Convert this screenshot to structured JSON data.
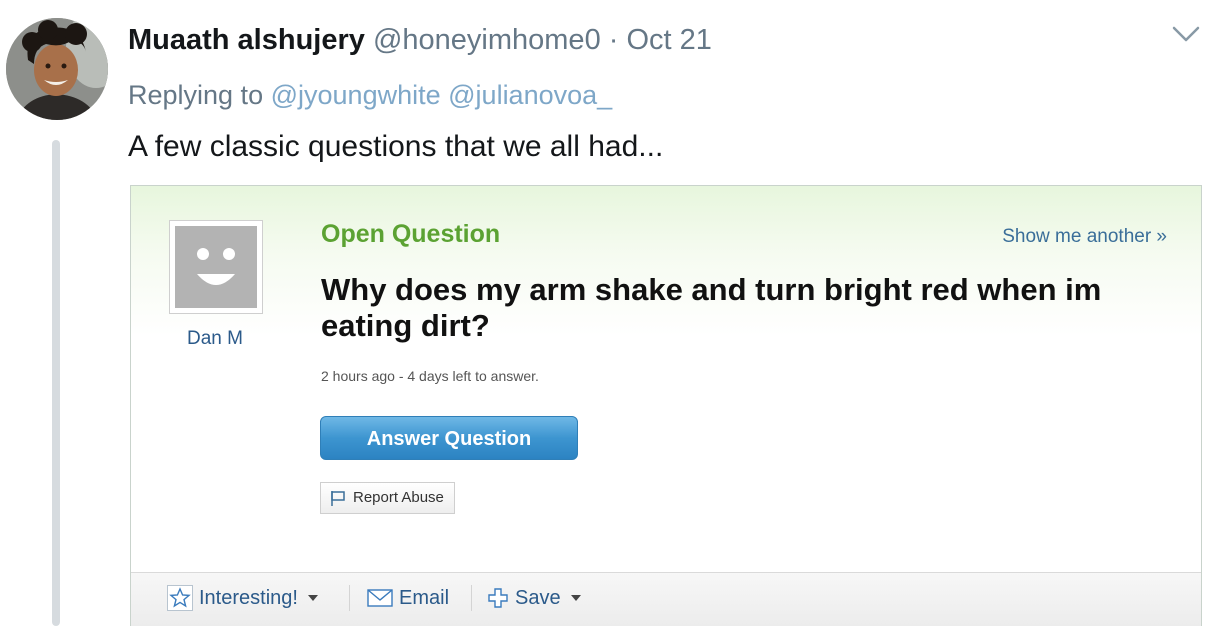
{
  "tweet": {
    "author_name": "Muaath alshujery",
    "author_handle": "@honeyimhome0",
    "separator": "·",
    "date": "Oct 21",
    "replying_prefix": "Replying to",
    "mentions": [
      "@jyoungwhite",
      "@julianovoa_"
    ],
    "text": "A few classic questions that we all had..."
  },
  "question_card": {
    "asker_name": "Dan M",
    "label": "Open Question",
    "show_another": "Show me another »",
    "title": "Why does my arm shake and turn bright red when im eating dirt?",
    "meta": "2 hours ago - 4 days left to answer.",
    "answer_button": "Answer Question",
    "report_button": "Report Abuse",
    "toolbar": {
      "interesting": "Interesting!",
      "email": "Email",
      "save": "Save"
    }
  },
  "colors": {
    "handle_gray": "#657786",
    "mention_blue": "#7ea7c8",
    "open_question_green": "#5ba232",
    "answer_button_blue": "#3d95d0",
    "link_blue": "#2b5a8a"
  },
  "icons": {
    "more": "chevron-down-icon",
    "report": "flag-icon",
    "interesting": "star-icon",
    "email": "envelope-icon",
    "save": "plus-icon"
  }
}
